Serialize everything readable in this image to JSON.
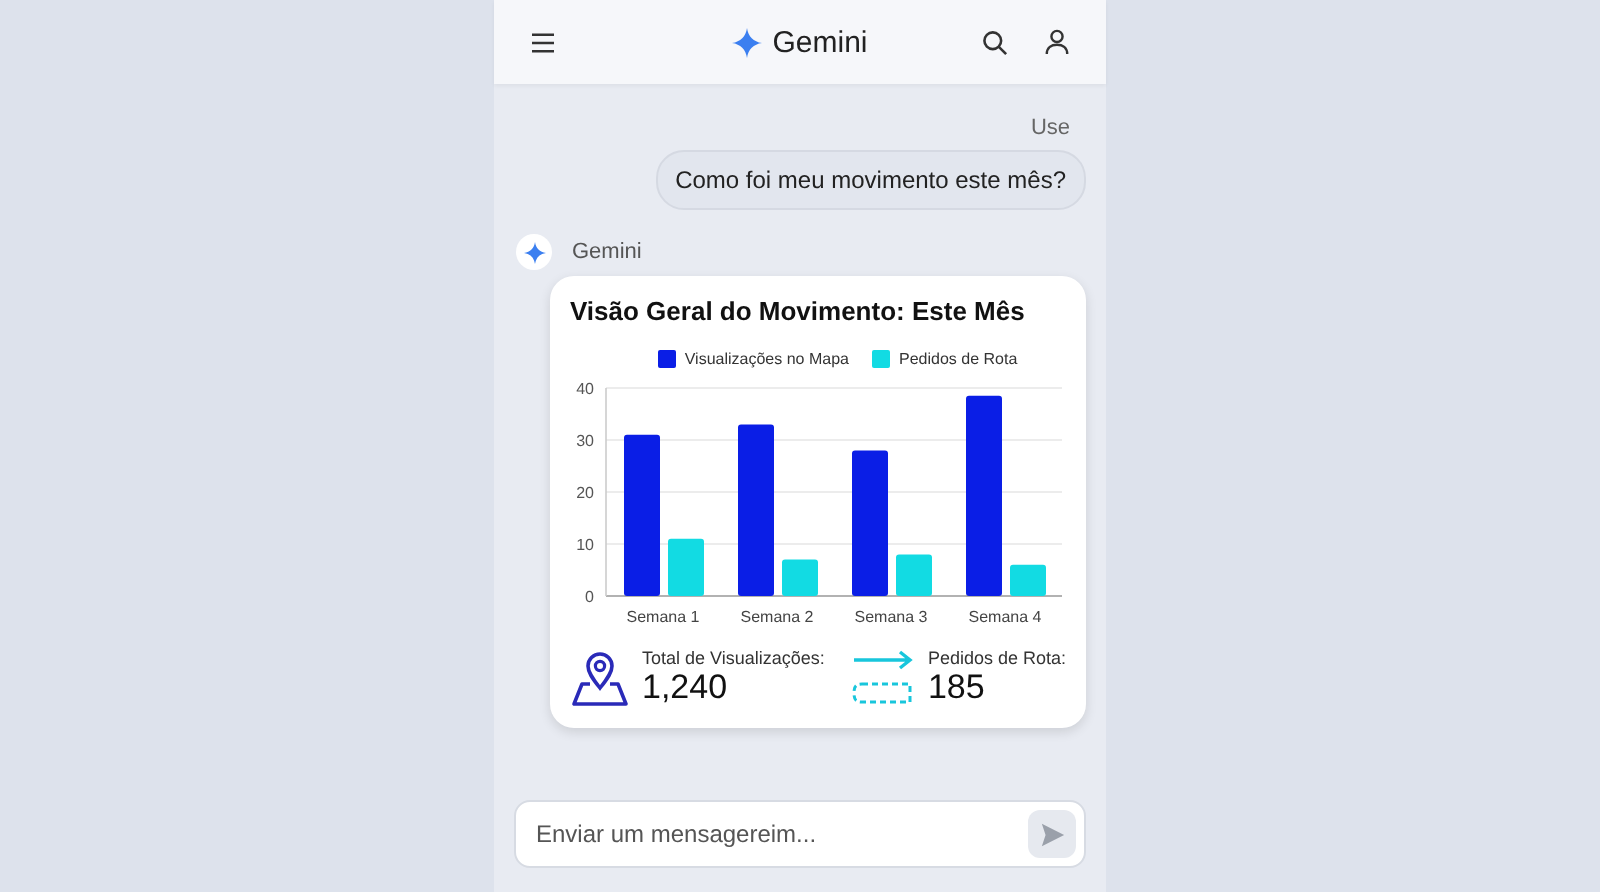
{
  "header": {
    "title": "Gemini"
  },
  "user_message": {
    "sender": "Use",
    "text": "Como foi meu movimento este mês?"
  },
  "assistant": {
    "name": "Gemini",
    "card": {
      "title": "Visão Geral do Movimento: Este Mês",
      "chart_data": {
        "type": "bar",
        "categories": [
          "Semana 1",
          "Semana 2",
          "Semana 3",
          "Semana 4"
        ],
        "series": [
          {
            "name": "Visualizações no Mapa",
            "color": "#0a1ee6",
            "values": [
              31,
              33,
              28,
              38.5
            ]
          },
          {
            "name": "Pedidos de Rota",
            "color": "#12dbe3",
            "values": [
              11,
              7,
              8,
              6
            ]
          }
        ],
        "ylim": [
          0,
          40
        ],
        "grid": true,
        "yticks": [
          0,
          10,
          20,
          30,
          40
        ]
      },
      "stats": [
        {
          "label": "Total de Visualizações:",
          "value": "1,240",
          "kind": "pin"
        },
        {
          "label": "Pedidos de Rota:",
          "value": "185",
          "kind": "route"
        }
      ]
    }
  },
  "composer": {
    "placeholder": "Enviar um mensagereim..."
  }
}
